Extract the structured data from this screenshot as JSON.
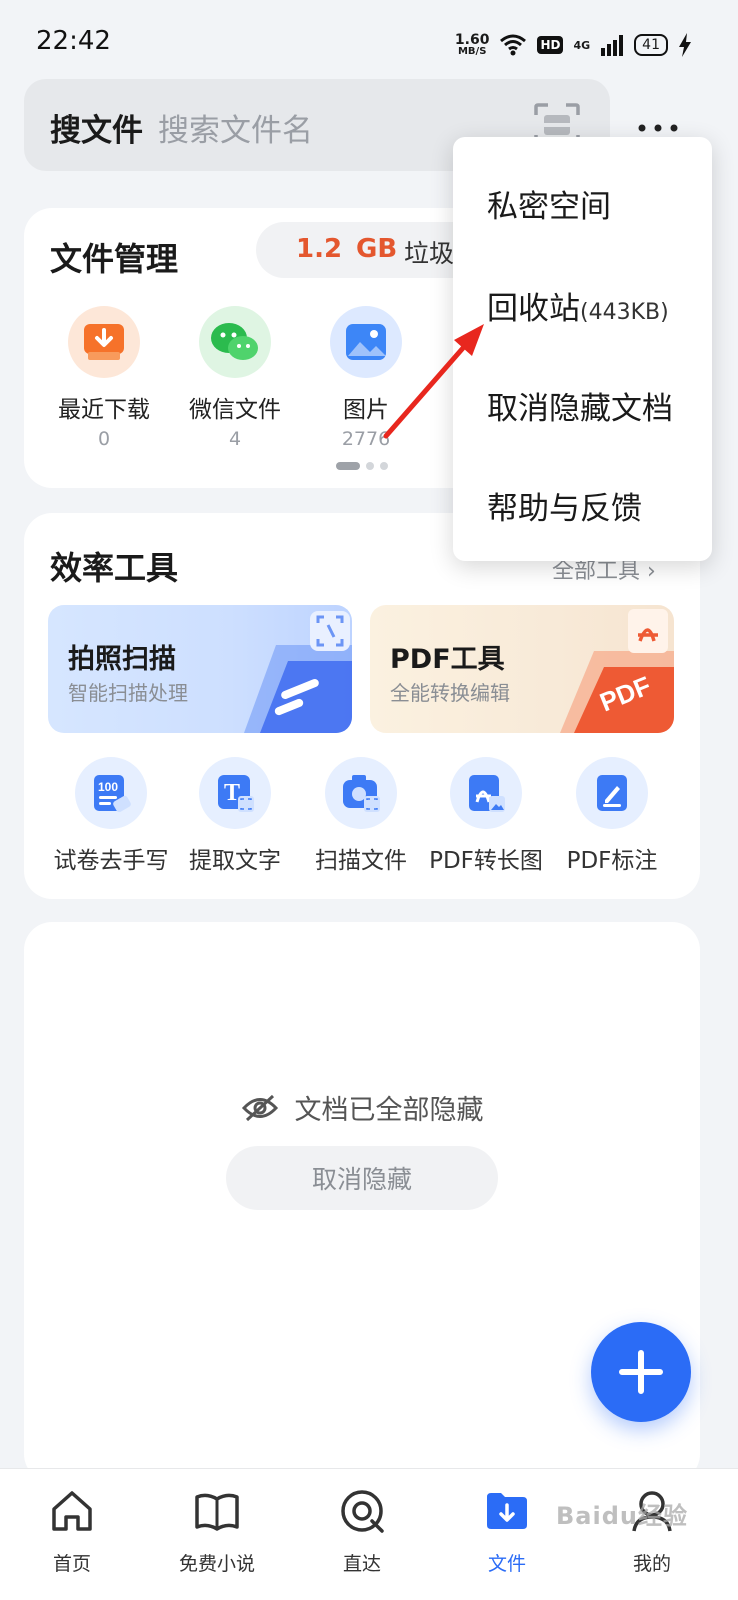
{
  "status_bar": {
    "time": "22:42",
    "net_speed_value": "1.60",
    "net_speed_unit": "MB/S",
    "hd": "HD",
    "signal": "4G",
    "battery": "41"
  },
  "search": {
    "label": "搜文件",
    "placeholder": "搜索文件名"
  },
  "file_manager": {
    "title": "文件管理",
    "junk_size": "1.2",
    "junk_unit": "GB",
    "junk_text": "垃圾待",
    "categories": [
      {
        "label": "最近下载",
        "count": "0",
        "icon": "download-icon"
      },
      {
        "label": "微信文件",
        "count": "4",
        "icon": "wechat-icon"
      },
      {
        "label": "图片",
        "count": "2776",
        "icon": "image-icon"
      }
    ]
  },
  "tools": {
    "title": "效率工具",
    "all_tools": "全部工具 ›",
    "features": [
      {
        "title": "拍照扫描",
        "subtitle": "智能扫描处理"
      },
      {
        "title": "PDF工具",
        "subtitle": "全能转换编辑"
      }
    ],
    "items": [
      {
        "label": "试卷去手写",
        "icon": "exam-eraser-icon"
      },
      {
        "label": "提取文字",
        "icon": "text-extract-icon"
      },
      {
        "label": "扫描文件",
        "icon": "scan-file-icon"
      },
      {
        "label": "PDF转长图",
        "icon": "pdf-to-image-icon"
      },
      {
        "label": "PDF标注",
        "icon": "pdf-annotate-icon"
      }
    ]
  },
  "hidden_docs": {
    "message": "文档已全部隐藏",
    "unhide_label": "取消隐藏"
  },
  "menu": {
    "items": [
      {
        "label": "私密空间"
      },
      {
        "label": "回收站",
        "size": "(443KB)"
      },
      {
        "label": "取消隐藏文档"
      },
      {
        "label": "帮助与反馈"
      }
    ]
  },
  "bottom_nav": {
    "items": [
      {
        "label": "首页",
        "icon": "home-icon"
      },
      {
        "label": "免费小说",
        "icon": "book-icon"
      },
      {
        "label": "直达",
        "icon": "direct-icon"
      },
      {
        "label": "文件",
        "icon": "folder-icon",
        "active": true
      },
      {
        "label": "我的",
        "icon": "profile-icon"
      }
    ]
  },
  "watermark": "Baidu经验",
  "colors": {
    "accent": "#2b6cf6",
    "junk": "#e4572e",
    "annotation_arrow": "#e8271e"
  }
}
